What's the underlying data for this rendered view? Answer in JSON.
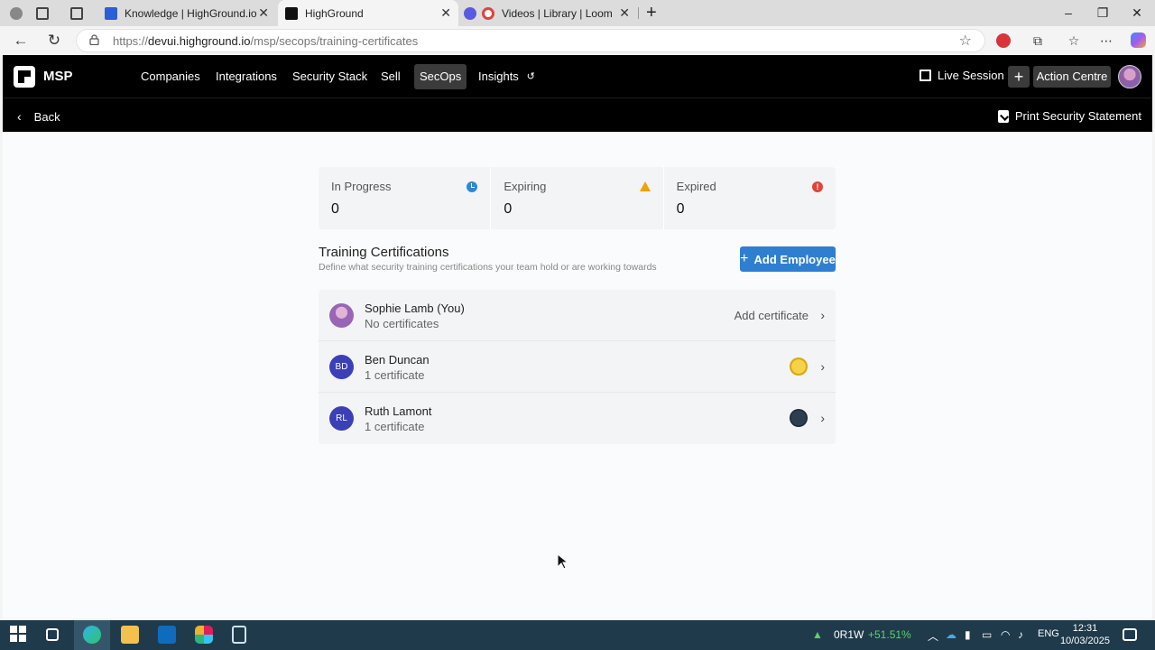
{
  "browser": {
    "tabs": [
      {
        "title": "Knowledge | HighGround.io | Inte",
        "active": false
      },
      {
        "title": "HighGround",
        "active": true
      },
      {
        "title": "Videos | Library | Loom",
        "active": false
      }
    ],
    "new_tab": "+",
    "url_domain": "devui.highground.io",
    "url_prefix": "https://",
    "url_path": "/msp/secops/training-certificates"
  },
  "app": {
    "brand": "MSP",
    "nav": [
      {
        "label": "Companies",
        "active": false
      },
      {
        "label": "Integrations",
        "active": false
      },
      {
        "label": "Security Stack",
        "active": false
      },
      {
        "label": "Sell",
        "active": false
      },
      {
        "label": "SecOps",
        "active": true
      },
      {
        "label": "Insights",
        "active": false
      }
    ],
    "live_session": "Live Session",
    "action_centre": "Action Centre",
    "back": "Back",
    "print_statement": "Print Security Statement"
  },
  "stats": [
    {
      "label": "In Progress",
      "value": "0",
      "icon": "clock-icon",
      "color": "#2f87d6"
    },
    {
      "label": "Expiring",
      "value": "0",
      "icon": "warning-icon",
      "color": "#f2a10b"
    },
    {
      "label": "Expired",
      "value": "0",
      "icon": "error-icon",
      "color": "#e0443a"
    }
  ],
  "section": {
    "title": "Training Certifications",
    "subtitle": "Define what security training certifications your team hold or are working towards",
    "add_employee": "Add Employee"
  },
  "employees": [
    {
      "initials": "",
      "name": "Sophie Lamb (You)",
      "certs": "No certificates",
      "action": "Add certificate"
    },
    {
      "initials": "BD",
      "name": "Ben Duncan",
      "certs": "1 certificate",
      "action": ""
    },
    {
      "initials": "RL",
      "name": "Ruth Lamont",
      "certs": "1 certificate",
      "action": ""
    }
  ],
  "taskbar": {
    "stock_name": "0R1W",
    "stock_change": "+51.51%",
    "lang": "ENG",
    "time": "12:31",
    "date": "10/03/2025"
  }
}
